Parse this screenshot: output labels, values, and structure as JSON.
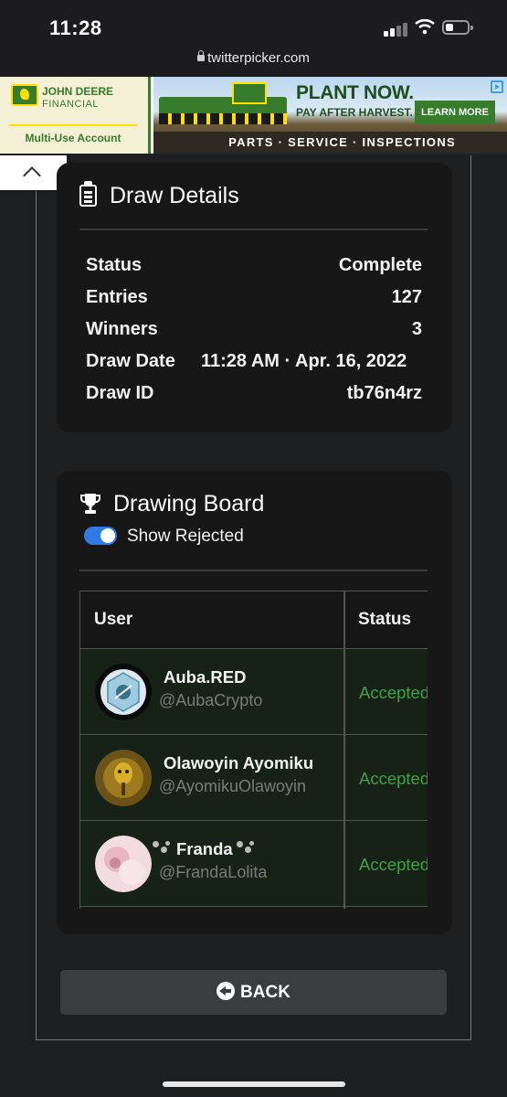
{
  "status_bar": {
    "time": "11:28",
    "url": "twitterpicker.com"
  },
  "ad": {
    "brand_line1": "JOHN DEERE",
    "brand_line2": "FINANCIAL",
    "account": "Multi-Use Account",
    "headline": "PLANT NOW.",
    "subline": "PAY AFTER HARVEST.",
    "cta": "LEARN MORE",
    "footer": "PARTS · SERVICE · INSPECTIONS",
    "brand_color": "#367c2b",
    "accent_color": "#ffde00"
  },
  "draw_details": {
    "title": "Draw Details",
    "icon": "clipboard-icon",
    "rows": [
      {
        "label": "Status",
        "value": "Complete"
      },
      {
        "label": "Entries",
        "value": "127"
      },
      {
        "label": "Winners",
        "value": "3"
      },
      {
        "label": "Draw Date",
        "value": "11:28 AM · Apr. 16, 2022"
      },
      {
        "label": "Draw ID",
        "value": "tb76n4rz"
      }
    ]
  },
  "drawing_board": {
    "title": "Drawing Board",
    "icon": "trophy-icon",
    "toggle_label": "Show Rejected",
    "toggle_on": true,
    "columns": [
      "User",
      "Status"
    ],
    "entries": [
      {
        "name": "Auba.RED",
        "handle": "@AubaCrypto",
        "status": "Accepted"
      },
      {
        "name": "Olawoyin Ayomiku",
        "handle": "@AyomikuOlawoyin",
        "status": "Accepted"
      },
      {
        "name": "Franda",
        "handle": "@FrandaLolita",
        "status": "Accepted"
      }
    ],
    "status_color": "#43a047"
  },
  "back_button": {
    "label": "BACK"
  }
}
